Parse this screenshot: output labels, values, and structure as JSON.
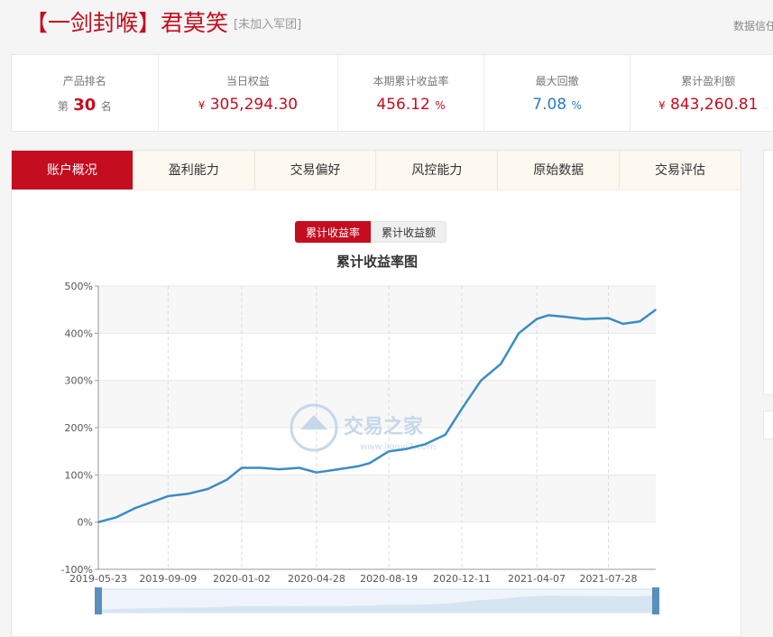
{
  "header": {
    "title_prefix": "【一剑封喉】",
    "title_name": "君莫笑",
    "title_tag": "[未加入军团]",
    "right_text": "数据信任"
  },
  "stats": {
    "rank": {
      "label": "产品排名",
      "prefix": "第",
      "value": "30",
      "suffix": "名"
    },
    "equity": {
      "label": "当日权益",
      "currency": "¥",
      "value": "305,294.30"
    },
    "return_rate": {
      "label": "本期累计收益率",
      "value": "456.12",
      "unit": "%"
    },
    "max_drawdown": {
      "label": "最大回撤",
      "value": "7.08",
      "unit": "%"
    },
    "profit": {
      "label": "累计盈利额",
      "currency": "¥",
      "value": "843,260.81"
    }
  },
  "tabs": [
    "账户概况",
    "盈利能力",
    "交易偏好",
    "风控能力",
    "原始数据",
    "交易评估"
  ],
  "toggle": {
    "active": "累计收益率",
    "inactive": "累计收益额"
  },
  "watermark": {
    "text": "交易之家",
    "url": "www.jiaoyi7.com"
  },
  "colors": {
    "accent": "#c40d1e",
    "line": "#3b8cc4",
    "blue_value": "#2e7bc4"
  },
  "chart_data": {
    "type": "line",
    "title": "累计收益率图",
    "xlabel": "",
    "ylabel": "",
    "ylim": [
      -100,
      500
    ],
    "yticks": [
      "500%",
      "400%",
      "300%",
      "200%",
      "100%",
      "0%",
      "-100%"
    ],
    "xticks": [
      "2019-05-23",
      "2019-09-09",
      "2020-01-02",
      "2020-04-28",
      "2020-08-19",
      "2020-12-11",
      "2021-04-07",
      "2021-07-28"
    ],
    "grid": "vertical dashed, horizontal bands",
    "series": [
      {
        "name": "",
        "x": [
          "2019-05-23",
          "2019-06-20",
          "2019-07-20",
          "2019-08-20",
          "2019-09-09",
          "2019-10-10",
          "2019-11-10",
          "2019-12-10",
          "2020-01-02",
          "2020-02-01",
          "2020-03-01",
          "2020-04-01",
          "2020-04-28",
          "2020-06-01",
          "2020-07-01",
          "2020-07-20",
          "2020-08-19",
          "2020-09-15",
          "2020-10-15",
          "2020-11-15",
          "2020-12-11",
          "2021-01-10",
          "2021-02-10",
          "2021-03-10",
          "2021-04-07",
          "2021-04-25",
          "2021-05-20",
          "2021-06-20",
          "2021-07-28",
          "2021-08-20",
          "2021-09-15",
          "2021-10-10"
        ],
        "values": [
          0,
          10,
          30,
          45,
          55,
          60,
          70,
          90,
          115,
          115,
          112,
          115,
          105,
          112,
          118,
          125,
          150,
          155,
          165,
          185,
          240,
          300,
          335,
          400,
          430,
          438,
          435,
          430,
          432,
          420,
          425,
          450
        ]
      }
    ]
  }
}
